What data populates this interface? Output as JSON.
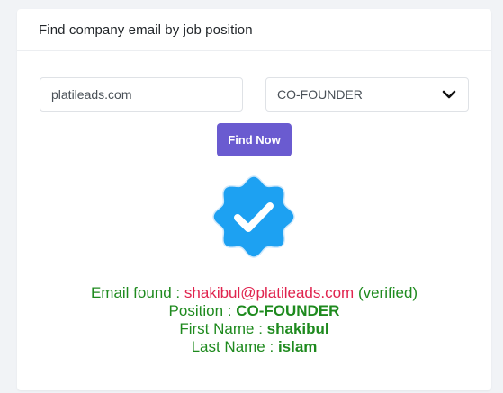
{
  "card": {
    "title": "Find company email by job position"
  },
  "form": {
    "domain_value": "platileads.com",
    "position_selected": "CO-FOUNDER",
    "find_button_label": "Find Now"
  },
  "icons": {
    "dropdown": "chevron-down-icon",
    "verified": "verified-badge-icon"
  },
  "result": {
    "email_label": "Email found :",
    "email": "shakibul@platileads.com",
    "email_status": "(verified)",
    "position_label": "Position :",
    "position": "CO-FOUNDER",
    "first_name_label": "First Name :",
    "first_name": "shakibul",
    "last_name_label": "Last Name :",
    "last_name": "islam"
  },
  "colors": {
    "accent_button": "#6a5bd0",
    "result_text": "#1e8a1e",
    "email_text": "#e0234e",
    "badge_blue": "#1da1f2"
  }
}
